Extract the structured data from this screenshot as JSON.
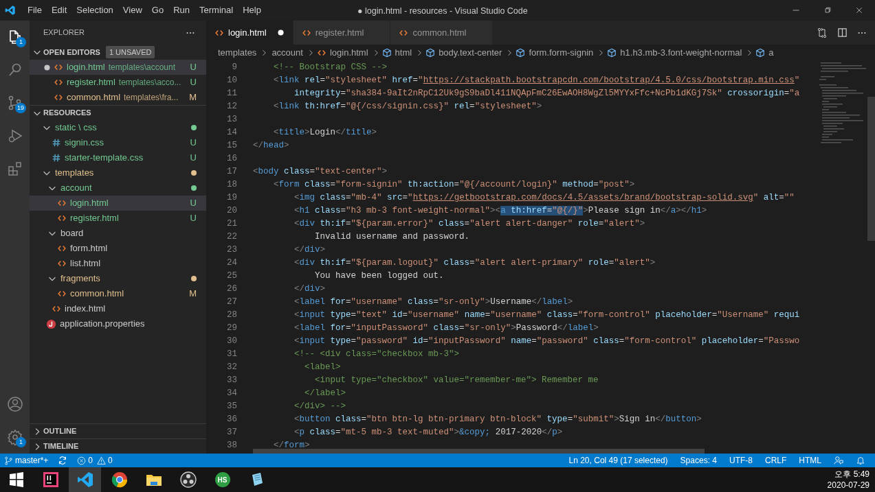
{
  "window": {
    "title": "● login.html - resources - Visual Studio Code"
  },
  "menu": [
    "File",
    "Edit",
    "Selection",
    "View",
    "Go",
    "Run",
    "Terminal",
    "Help"
  ],
  "activity_bar": {
    "items": [
      {
        "kind": "explorer",
        "selected": true,
        "badge": "1"
      },
      {
        "kind": "search",
        "selected": false
      },
      {
        "kind": "scm",
        "selected": false,
        "badge": "19"
      },
      {
        "kind": "debug",
        "selected": false
      },
      {
        "kind": "extensions",
        "selected": false
      }
    ],
    "bottom": [
      {
        "kind": "account"
      },
      {
        "kind": "settings",
        "badge": "1"
      }
    ]
  },
  "explorer": {
    "title": "EXPLORER",
    "open_editors": {
      "title": "OPEN EDITORS",
      "expanded": true,
      "badge": "1 UNSAVED",
      "items": [
        {
          "label": "login.html",
          "kind": "html",
          "description": "templates\\account",
          "status": "U",
          "color": "#73c991",
          "modified": true,
          "selected": true
        },
        {
          "label": "register.html",
          "kind": "html",
          "description": "templates\\acco...",
          "status": "U",
          "color": "#73c991",
          "modified": false,
          "selected": false
        },
        {
          "label": "common.html",
          "kind": "html",
          "description": "templates\\fra...",
          "status": "M",
          "color": "#e2c08d",
          "modified": false,
          "selected": false
        }
      ]
    },
    "resources": {
      "title": "RESOURCES",
      "expanded": true,
      "items": [
        {
          "label": "static \\ css",
          "kind": "folder",
          "expanded": true,
          "color": "#73c991",
          "selected": false,
          "children": [
            {
              "label": "signin.css",
              "kind": "css",
              "status": "U",
              "color": "#73c991",
              "selected": false
            },
            {
              "label": "starter-template.css",
              "kind": "css",
              "status": "U",
              "color": "#73c991",
              "selected": false
            }
          ]
        },
        {
          "label": "templates",
          "kind": "folder",
          "expanded": true,
          "color": "#e2c08d",
          "selected": false,
          "children": [
            {
              "label": "account",
              "kind": "folder",
              "expanded": true,
              "color": "#73c991",
              "selected": false,
              "children": [
                {
                  "label": "login.html",
                  "kind": "html",
                  "status": "U",
                  "color": "#73c991",
                  "selected": true
                },
                {
                  "label": "register.html",
                  "kind": "html",
                  "status": "U",
                  "color": "#73c991",
                  "selected": false
                }
              ]
            },
            {
              "label": "board",
              "kind": "folder",
              "expanded": true,
              "selected": false,
              "children": [
                {
                  "label": "form.html",
                  "kind": "html",
                  "selected": false
                },
                {
                  "label": "list.html",
                  "kind": "html",
                  "selected": false
                }
              ]
            },
            {
              "label": "fragments",
              "kind": "folder",
              "expanded": true,
              "color": "#e2c08d",
              "selected": false,
              "children": [
                {
                  "label": "common.html",
                  "kind": "html",
                  "status": "M",
                  "color": "#e2c08d",
                  "selected": false
                }
              ]
            },
            {
              "label": "index.html",
              "kind": "html",
              "selected": false
            }
          ]
        },
        {
          "label": "application.properties",
          "kind": "properties",
          "selected": false
        }
      ]
    },
    "sections": [
      {
        "title": "OUTLINE",
        "expanded": false
      },
      {
        "title": "TIMELINE",
        "expanded": false
      }
    ]
  },
  "tabs": [
    {
      "label": "login.html",
      "selected": true,
      "modified": true
    },
    {
      "label": "register.html",
      "selected": false,
      "modified": false
    },
    {
      "label": "common.html",
      "selected": false,
      "modified": false
    }
  ],
  "breadcrumb": [
    {
      "label": "templates",
      "kind": "folder"
    },
    {
      "label": "account",
      "kind": "folder"
    },
    {
      "label": "login.html",
      "kind": "html"
    },
    {
      "label": "html",
      "kind": "element"
    },
    {
      "label": "body.text-center",
      "kind": "element"
    },
    {
      "label": "form.form-signin",
      "kind": "element"
    },
    {
      "label": "h1.h3.mb-3.font-weight-normal",
      "kind": "element"
    },
    {
      "label": "a",
      "kind": "element"
    }
  ],
  "code": [
    {
      "number": "9",
      "tokens": [
        {
          "kind": "com",
          "text": "    <!-- Bootstrap CSS -->"
        }
      ]
    },
    {
      "number": "10",
      "tokens": [
        {
          "kind": "p",
          "text": "    <"
        },
        {
          "kind": "tag",
          "text": "link"
        },
        {
          "kind": "attr",
          "text": " rel"
        },
        {
          "kind": "txt",
          "text": "="
        },
        {
          "kind": "str",
          "text": "\"stylesheet\""
        },
        {
          "kind": "attr",
          "text": " href"
        },
        {
          "kind": "txt",
          "text": "="
        },
        {
          "kind": "str",
          "text": "\""
        },
        {
          "kind": "url",
          "text": "https://stackpath.bootstrapcdn.com/bootstrap/4.5.0/css/bootstrap.min.css"
        },
        {
          "kind": "str",
          "text": "\""
        }
      ]
    },
    {
      "number": "11",
      "tokens": [
        {
          "kind": "attr",
          "text": "        integrity"
        },
        {
          "kind": "txt",
          "text": "="
        },
        {
          "kind": "str",
          "text": "\"sha384-9aIt2nRpC12Uk9gS9baDl411NQApFmC26EwAOH8WgZl5MYYxFfc+NcPb1dKGj7Sk\""
        },
        {
          "kind": "attr",
          "text": " crossorigin"
        },
        {
          "kind": "txt",
          "text": "="
        },
        {
          "kind": "str",
          "text": "\"a"
        }
      ]
    },
    {
      "number": "12",
      "tokens": [
        {
          "kind": "p",
          "text": "    <"
        },
        {
          "kind": "tag",
          "text": "link"
        },
        {
          "kind": "attr",
          "text": " th:href"
        },
        {
          "kind": "txt",
          "text": "="
        },
        {
          "kind": "str",
          "text": "\"@{/css/signin.css}\""
        },
        {
          "kind": "attr",
          "text": " rel"
        },
        {
          "kind": "txt",
          "text": "="
        },
        {
          "kind": "str",
          "text": "\"stylesheet\""
        },
        {
          "kind": "p",
          "text": ">"
        }
      ]
    },
    {
      "number": "13"
    },
    {
      "number": "14",
      "tokens": [
        {
          "kind": "p",
          "text": "    <"
        },
        {
          "kind": "tag",
          "text": "title"
        },
        {
          "kind": "p",
          "text": ">"
        },
        {
          "kind": "txt",
          "text": "Login"
        },
        {
          "kind": "p",
          "text": "</"
        },
        {
          "kind": "tag",
          "text": "title"
        },
        {
          "kind": "p",
          "text": ">"
        }
      ]
    },
    {
      "number": "15",
      "tokens": [
        {
          "kind": "p",
          "text": "</"
        },
        {
          "kind": "tag",
          "text": "head"
        },
        {
          "kind": "p",
          "text": ">"
        }
      ]
    },
    {
      "number": "16"
    },
    {
      "number": "17",
      "tokens": [
        {
          "kind": "p",
          "text": "<"
        },
        {
          "kind": "tag",
          "text": "body"
        },
        {
          "kind": "attr",
          "text": " class"
        },
        {
          "kind": "txt",
          "text": "="
        },
        {
          "kind": "str",
          "text": "\"text-center\""
        },
        {
          "kind": "p",
          "text": ">"
        }
      ]
    },
    {
      "number": "18",
      "tokens": [
        {
          "kind": "p",
          "text": "    <"
        },
        {
          "kind": "tag",
          "text": "form"
        },
        {
          "kind": "attr",
          "text": " class"
        },
        {
          "kind": "txt",
          "text": "="
        },
        {
          "kind": "str",
          "text": "\"form-signin\""
        },
        {
          "kind": "attr",
          "text": " th:action"
        },
        {
          "kind": "txt",
          "text": "="
        },
        {
          "kind": "str",
          "text": "\"@{/account/login}\""
        },
        {
          "kind": "attr",
          "text": " method"
        },
        {
          "kind": "txt",
          "text": "="
        },
        {
          "kind": "str",
          "text": "\"post\""
        },
        {
          "kind": "p",
          "text": ">"
        }
      ]
    },
    {
      "number": "19",
      "tokens": [
        {
          "kind": "p",
          "text": "        <"
        },
        {
          "kind": "tag",
          "text": "img"
        },
        {
          "kind": "attr",
          "text": " class"
        },
        {
          "kind": "txt",
          "text": "="
        },
        {
          "kind": "str",
          "text": "\"mb-4\""
        },
        {
          "kind": "attr",
          "text": " src"
        },
        {
          "kind": "txt",
          "text": "="
        },
        {
          "kind": "str",
          "text": "\""
        },
        {
          "kind": "url",
          "text": "https://getbootstrap.com/docs/4.5/assets/brand/bootstrap-solid.svg"
        },
        {
          "kind": "str",
          "text": "\""
        },
        {
          "kind": "attr",
          "text": " alt"
        },
        {
          "kind": "txt",
          "text": "="
        },
        {
          "kind": "str",
          "text": "\"\""
        }
      ]
    },
    {
      "number": "20",
      "tokens": [
        {
          "kind": "p",
          "text": "        <",
          "selected": false
        },
        {
          "kind": "tag",
          "text": "h1",
          "selected": false
        },
        {
          "kind": "attr",
          "text": " class",
          "selected": false
        },
        {
          "kind": "txt",
          "text": "=",
          "selected": false
        },
        {
          "kind": "str",
          "text": "\"h3 mb-3 font-weight-normal\"",
          "selected": false
        },
        {
          "kind": "p",
          "text": "><",
          "selected": false
        },
        {
          "kind": "tag",
          "text": "a",
          "selected": true
        },
        {
          "kind": "attr",
          "text": " th:href",
          "selected": true
        },
        {
          "kind": "txt",
          "text": "=",
          "selected": true
        },
        {
          "kind": "str",
          "text": "\"@{/}\"",
          "selected": true
        },
        {
          "kind": "p",
          "text": ">",
          "selected": false
        },
        {
          "kind": "txt",
          "text": "Please sign in",
          "selected": false
        },
        {
          "kind": "p",
          "text": "</",
          "selected": false
        },
        {
          "kind": "tag",
          "text": "a",
          "selected": false
        },
        {
          "kind": "p",
          "text": "></",
          "selected": false
        },
        {
          "kind": "tag",
          "text": "h1",
          "selected": false
        },
        {
          "kind": "p",
          "text": ">",
          "selected": false
        }
      ]
    },
    {
      "number": "21",
      "tokens": [
        {
          "kind": "p",
          "text": "        <"
        },
        {
          "kind": "tag",
          "text": "div"
        },
        {
          "kind": "attr",
          "text": " th:if"
        },
        {
          "kind": "txt",
          "text": "="
        },
        {
          "kind": "str",
          "text": "\"${param.error}\""
        },
        {
          "kind": "attr",
          "text": " class"
        },
        {
          "kind": "txt",
          "text": "="
        },
        {
          "kind": "str",
          "text": "\"alert alert-danger\""
        },
        {
          "kind": "attr",
          "text": " role"
        },
        {
          "kind": "txt",
          "text": "="
        },
        {
          "kind": "str",
          "text": "\"alert\""
        },
        {
          "kind": "p",
          "text": ">"
        }
      ]
    },
    {
      "number": "22",
      "tokens": [
        {
          "kind": "txt",
          "text": "            Invalid username and password."
        }
      ]
    },
    {
      "number": "23",
      "tokens": [
        {
          "kind": "p",
          "text": "        </"
        },
        {
          "kind": "tag",
          "text": "div"
        },
        {
          "kind": "p",
          "text": ">"
        }
      ]
    },
    {
      "number": "24",
      "tokens": [
        {
          "kind": "p",
          "text": "        <"
        },
        {
          "kind": "tag",
          "text": "div"
        },
        {
          "kind": "attr",
          "text": " th:if"
        },
        {
          "kind": "txt",
          "text": "="
        },
        {
          "kind": "str",
          "text": "\"${param.logout}\""
        },
        {
          "kind": "attr",
          "text": " class"
        },
        {
          "kind": "txt",
          "text": "="
        },
        {
          "kind": "str",
          "text": "\"alert alert-primary\""
        },
        {
          "kind": "attr",
          "text": " role"
        },
        {
          "kind": "txt",
          "text": "="
        },
        {
          "kind": "str",
          "text": "\"alert\""
        },
        {
          "kind": "p",
          "text": ">"
        }
      ]
    },
    {
      "number": "25",
      "tokens": [
        {
          "kind": "txt",
          "text": "            You have been logged out."
        }
      ]
    },
    {
      "number": "26",
      "tokens": [
        {
          "kind": "p",
          "text": "        </"
        },
        {
          "kind": "tag",
          "text": "div"
        },
        {
          "kind": "p",
          "text": ">"
        }
      ]
    },
    {
      "number": "27",
      "tokens": [
        {
          "kind": "p",
          "text": "        <"
        },
        {
          "kind": "tag",
          "text": "label"
        },
        {
          "kind": "attr",
          "text": " for"
        },
        {
          "kind": "txt",
          "text": "="
        },
        {
          "kind": "str",
          "text": "\"username\""
        },
        {
          "kind": "attr",
          "text": " class"
        },
        {
          "kind": "txt",
          "text": "="
        },
        {
          "kind": "str",
          "text": "\"sr-only\""
        },
        {
          "kind": "p",
          "text": ">"
        },
        {
          "kind": "txt",
          "text": "Username"
        },
        {
          "kind": "p",
          "text": "</"
        },
        {
          "kind": "tag",
          "text": "label"
        },
        {
          "kind": "p",
          "text": ">"
        }
      ]
    },
    {
      "number": "28",
      "tokens": [
        {
          "kind": "p",
          "text": "        <"
        },
        {
          "kind": "tag",
          "text": "input"
        },
        {
          "kind": "attr",
          "text": " type"
        },
        {
          "kind": "txt",
          "text": "="
        },
        {
          "kind": "str",
          "text": "\"text\""
        },
        {
          "kind": "attr",
          "text": " id"
        },
        {
          "kind": "txt",
          "text": "="
        },
        {
          "kind": "str",
          "text": "\"username\""
        },
        {
          "kind": "attr",
          "text": " name"
        },
        {
          "kind": "txt",
          "text": "="
        },
        {
          "kind": "str",
          "text": "\"username\""
        },
        {
          "kind": "attr",
          "text": " class"
        },
        {
          "kind": "txt",
          "text": "="
        },
        {
          "kind": "str",
          "text": "\"form-control\""
        },
        {
          "kind": "attr",
          "text": " placeholder"
        },
        {
          "kind": "txt",
          "text": "="
        },
        {
          "kind": "str",
          "text": "\"Username\""
        },
        {
          "kind": "attr",
          "text": " requi"
        }
      ]
    },
    {
      "number": "29",
      "tokens": [
        {
          "kind": "p",
          "text": "        <"
        },
        {
          "kind": "tag",
          "text": "label"
        },
        {
          "kind": "attr",
          "text": " for"
        },
        {
          "kind": "txt",
          "text": "="
        },
        {
          "kind": "str",
          "text": "\"inputPassword\""
        },
        {
          "kind": "attr",
          "text": " class"
        },
        {
          "kind": "txt",
          "text": "="
        },
        {
          "kind": "str",
          "text": "\"sr-only\""
        },
        {
          "kind": "p",
          "text": ">"
        },
        {
          "kind": "txt",
          "text": "Password"
        },
        {
          "kind": "p",
          "text": "</"
        },
        {
          "kind": "tag",
          "text": "label"
        },
        {
          "kind": "p",
          "text": ">"
        }
      ]
    },
    {
      "number": "30",
      "tokens": [
        {
          "kind": "p",
          "text": "        <"
        },
        {
          "kind": "tag",
          "text": "input"
        },
        {
          "kind": "attr",
          "text": " type"
        },
        {
          "kind": "txt",
          "text": "="
        },
        {
          "kind": "str",
          "text": "\"password\""
        },
        {
          "kind": "attr",
          "text": " id"
        },
        {
          "kind": "txt",
          "text": "="
        },
        {
          "kind": "str",
          "text": "\"inputPassword\""
        },
        {
          "kind": "attr",
          "text": " name"
        },
        {
          "kind": "txt",
          "text": "="
        },
        {
          "kind": "str",
          "text": "\"password\""
        },
        {
          "kind": "attr",
          "text": " class"
        },
        {
          "kind": "txt",
          "text": "="
        },
        {
          "kind": "str",
          "text": "\"form-control\""
        },
        {
          "kind": "attr",
          "text": " placeholder"
        },
        {
          "kind": "txt",
          "text": "="
        },
        {
          "kind": "str",
          "text": "\"Passwo"
        }
      ]
    },
    {
      "number": "31",
      "tokens": [
        {
          "kind": "com",
          "text": "        <!-- <div class=\"checkbox mb-3\">"
        }
      ]
    },
    {
      "number": "32",
      "tokens": [
        {
          "kind": "com",
          "text": "          <label>"
        }
      ]
    },
    {
      "number": "33",
      "tokens": [
        {
          "kind": "com",
          "text": "            <input type=\"checkbox\" value=\"remember-me\"> Remember me"
        }
      ]
    },
    {
      "number": "34",
      "tokens": [
        {
          "kind": "com",
          "text": "          </label>"
        }
      ]
    },
    {
      "number": "35",
      "tokens": [
        {
          "kind": "com",
          "text": "        </div> -->"
        }
      ]
    },
    {
      "number": "36",
      "tokens": [
        {
          "kind": "p",
          "text": "        <"
        },
        {
          "kind": "tag",
          "text": "button"
        },
        {
          "kind": "attr",
          "text": " class"
        },
        {
          "kind": "txt",
          "text": "="
        },
        {
          "kind": "str",
          "text": "\"btn btn-lg btn-primary btn-block\""
        },
        {
          "kind": "attr",
          "text": " type"
        },
        {
          "kind": "txt",
          "text": "="
        },
        {
          "kind": "str",
          "text": "\"submit\""
        },
        {
          "kind": "p",
          "text": ">"
        },
        {
          "kind": "txt",
          "text": "Sign in"
        },
        {
          "kind": "p",
          "text": "</"
        },
        {
          "kind": "tag",
          "text": "button"
        },
        {
          "kind": "p",
          "text": ">"
        }
      ]
    },
    {
      "number": "37",
      "tokens": [
        {
          "kind": "p",
          "text": "        <"
        },
        {
          "kind": "tag",
          "text": "p"
        },
        {
          "kind": "attr",
          "text": " class"
        },
        {
          "kind": "txt",
          "text": "="
        },
        {
          "kind": "str",
          "text": "\"mt-5 mb-3 text-muted\""
        },
        {
          "kind": "p",
          "text": ">"
        },
        {
          "kind": "ent",
          "text": "&copy;"
        },
        {
          "kind": "txt",
          "text": " 2017-2020"
        },
        {
          "kind": "p",
          "text": "</"
        },
        {
          "kind": "tag",
          "text": "p"
        },
        {
          "kind": "p",
          "text": ">"
        }
      ]
    },
    {
      "number": "38",
      "tokens": [
        {
          "kind": "p",
          "text": "    </"
        },
        {
          "kind": "tag",
          "text": "form"
        },
        {
          "kind": "p",
          "text": ">"
        }
      ]
    }
  ],
  "status_bar": {
    "left": [
      {
        "kind": "branch",
        "text": "master*+"
      },
      {
        "kind": "sync"
      },
      {
        "kind": "problems",
        "errors": "0",
        "warnings": "0"
      }
    ],
    "right": [
      {
        "kind": "text",
        "text": "Ln 20, Col 49 (17 selected)"
      },
      {
        "kind": "text",
        "text": "Spaces: 4"
      },
      {
        "kind": "text",
        "text": "UTF-8"
      },
      {
        "kind": "text",
        "text": "CRLF"
      },
      {
        "kind": "text",
        "text": "HTML"
      },
      {
        "kind": "feedback"
      },
      {
        "kind": "bell"
      }
    ]
  },
  "taskbar": {
    "apps": [
      {
        "kind": "windows",
        "selected": false
      },
      {
        "kind": "intellij",
        "selected": false
      },
      {
        "kind": "vscode",
        "selected": true
      },
      {
        "kind": "chrome",
        "selected": false
      },
      {
        "kind": "files",
        "selected": false
      },
      {
        "kind": "obs",
        "selected": false
      },
      {
        "kind": "hs",
        "label": "HS",
        "selected": false
      },
      {
        "kind": "notepad",
        "selected": false
      }
    ],
    "time": "오후 5:49",
    "date": "2020-07-29"
  }
}
